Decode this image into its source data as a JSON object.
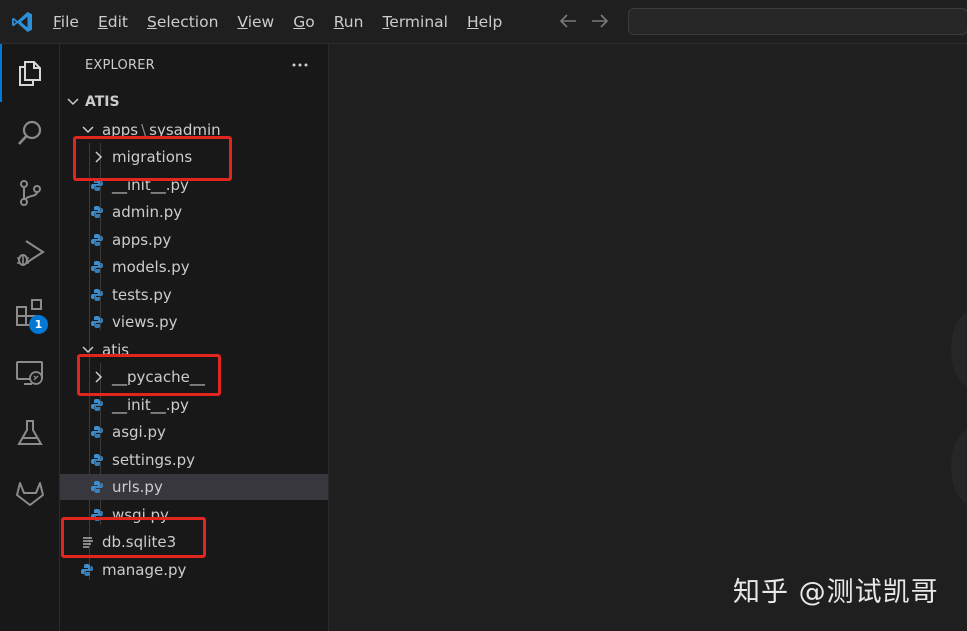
{
  "menu": {
    "items": [
      {
        "key": "F",
        "rest": "ile"
      },
      {
        "key": "E",
        "rest": "dit"
      },
      {
        "key": "S",
        "rest": "election"
      },
      {
        "key": "V",
        "rest": "iew"
      },
      {
        "key": "G",
        "rest": "o"
      },
      {
        "key": "R",
        "rest": "un"
      },
      {
        "key": "T",
        "rest": "erminal"
      },
      {
        "key": "H",
        "rest": "elp"
      }
    ]
  },
  "activity": {
    "extensions_badge": "1"
  },
  "explorer": {
    "title": "EXPLORER",
    "root": "ATIS",
    "apps_folder": "apps",
    "apps_sub": "sysadmin",
    "files": [
      {
        "name": "migrations",
        "kind": "folder"
      },
      {
        "name": "__init__.py",
        "kind": "py"
      },
      {
        "name": "admin.py",
        "kind": "py"
      },
      {
        "name": "apps.py",
        "kind": "py"
      },
      {
        "name": "models.py",
        "kind": "py"
      },
      {
        "name": "tests.py",
        "kind": "py"
      },
      {
        "name": "views.py",
        "kind": "py"
      },
      {
        "name": "atis",
        "kind": "open-folder"
      },
      {
        "name": "__pycache__",
        "kind": "folder"
      },
      {
        "name": "__init__.py",
        "kind": "py"
      },
      {
        "name": "asgi.py",
        "kind": "py"
      },
      {
        "name": "settings.py",
        "kind": "py"
      },
      {
        "name": "urls.py",
        "kind": "py"
      },
      {
        "name": "wsgi.py",
        "kind": "py"
      },
      {
        "name": "db.sqlite3",
        "kind": "txt"
      },
      {
        "name": "manage.py",
        "kind": "py"
      }
    ]
  },
  "watermark": "知乎 @测试凯哥",
  "colors": {
    "accent": "#0078d4",
    "highlight": "#e0261f",
    "python_icon": "#3c8fd1"
  }
}
